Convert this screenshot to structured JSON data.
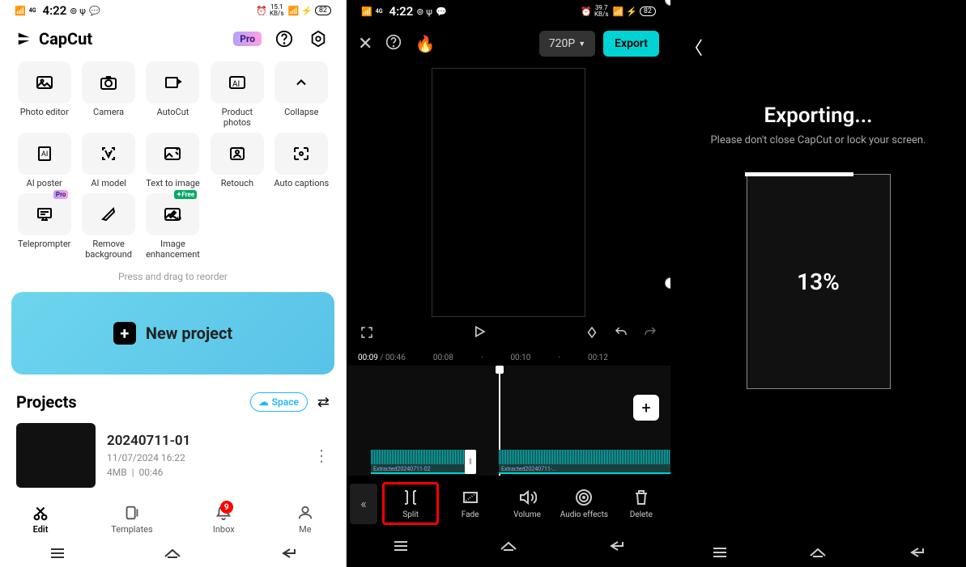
{
  "status": {
    "time": "4:22",
    "speed1": "15.1",
    "speed2": "39.7",
    "speedUnit": "KB/s",
    "battery": "82"
  },
  "s1": {
    "appName": "CapCut",
    "pro": "Pro",
    "tools": {
      "photo_editor": "Photo editor",
      "camera": "Camera",
      "autocut": "AutoCut",
      "product_photos": "Product photos",
      "collapse": "Collapse",
      "ai_poster": "AI poster",
      "ai_model": "AI model",
      "text_to_image": "Text to image",
      "retouch": "Retouch",
      "auto_captions": "Auto captions",
      "teleprompter": "Teleprompter",
      "remove_bg": "Remove background",
      "image_enh": "Image enhancement"
    },
    "badge_pro": "Pro",
    "badge_free": "✦Free",
    "reorder_hint": "Press and drag to reorder",
    "new_project": "New project",
    "projects_title": "Projects",
    "space_btn": "Space",
    "project": {
      "name": "20240711-01",
      "date": "11/07/2024 16:22",
      "size": "4MB",
      "duration": "00:46"
    },
    "tabs": {
      "edit": "Edit",
      "templates": "Templates",
      "inbox": "Inbox",
      "me": "Me",
      "inbox_badge": "9"
    }
  },
  "s2": {
    "resolution": "720P",
    "export": "Export",
    "time_current": "00:09",
    "time_total": "00:46",
    "ticks": {
      "t1": "00:08",
      "t2": "00:10",
      "t3": "00:12"
    },
    "clip1": "Extracted20240711-02",
    "clip2": "Extracted20240711-...",
    "tools": {
      "split": "Split",
      "fade": "Fade",
      "volume": "Volume",
      "audio_effects": "Audio effects",
      "delete": "Delete"
    }
  },
  "s3": {
    "title": "Exporting...",
    "subtitle": "Please don't close CapCut or lock your screen.",
    "percent": "13%"
  }
}
